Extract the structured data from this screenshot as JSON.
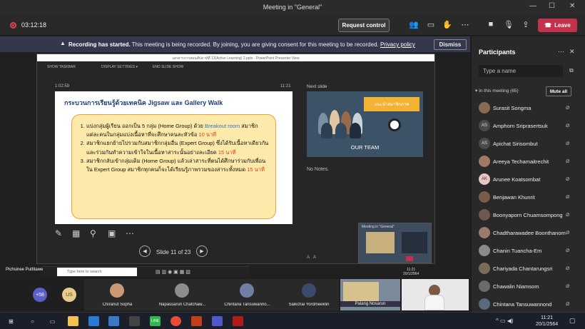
{
  "window": {
    "title": "Meeting in \"General\""
  },
  "toolbar": {
    "timer": "03:12:18",
    "request_control_label": "Request control",
    "leave_label": "Leave"
  },
  "banner": {
    "title": "Recording has started.",
    "message": "This meeting is being recorded. By joining, you are giving consent for this meeting to be recorded.",
    "link": "Privacy policy",
    "dismiss_label": "Dismiss"
  },
  "presenter": {
    "window_title": "เอกสารการสอนสัปดาห์ที่ 13(Active Learning) 2.pptx - PowerPoint Presenter View",
    "menu": [
      "SHOW TASKBAR",
      "DISPLAY SETTINGS ▾",
      "END SLIDE SHOW"
    ],
    "elapsed": "1:02:59",
    "clock": "11:21",
    "next_slide_label": "Next slide",
    "next_slide": {
      "banner": "แนะนำสมาชิกภาพ",
      "caption": "OUR TEAM"
    },
    "notes": "No Notes.",
    "slide_counter": "Slide 11 of 23",
    "slide": {
      "title": "กระบวนการเรียนรู้ด้วยเทคนิค Jigsaw และ Gallery Walk",
      "items": [
        {
          "pre": "แบ่งกลุ่มผู้เรียน ออกเป็น 5 กลุ่ม (Home Group) ด้วย ",
          "highlight": "Breakout room",
          "mid": " สมาชิกแต่ละคนในกลุ่มแบ่งเนื้อหาที่จะศึกษาคนละหัวข้อ ",
          "time": "10 นาที"
        },
        {
          "pre": "สมาชิกแยกย้ายไปรวมกับสมาชิกกลุ่มอื่น (Expert Group) ซึ่งได้รับเนื้อหาเดียวกัน และร่วมกันทำความเข้าใจในเนื้อหาสาระนั้นอย่างละเอียด ",
          "time": "15 นาที"
        },
        {
          "pre": "สมาชิกกลับเข้ากลุ่มเดิม (Home Group) แล้วเล่าสาระที่ตนได้ศึกษาร่วมกับเพื่อนใน Expert Group สมาชิกทุกคนก็จะได้เรียนรู้ภาพรวมของสาระทั้งหมด ",
          "time": "15 นาที"
        }
      ]
    },
    "presenter_name": "Pichsinee Puttitawesri",
    "inner_search_placeholder": "Type here to search",
    "inner_clock": "11:21",
    "inner_date": "20/1/2564",
    "mini_preview_title": "Meeting in \"General\""
  },
  "tiles": [
    {
      "label": "+58"
    },
    {
      "initials": "US"
    },
    {
      "name": "Chiranut Sopha"
    },
    {
      "name": "Napassarun Chatchaw..."
    },
    {
      "name": "Chintana Tansuwanno..."
    },
    {
      "name": "Saikchai Yordmeeklin"
    },
    {
      "name": "Palang Nosarun"
    }
  ],
  "participants": {
    "title": "Participants",
    "search_placeholder": "Type a name",
    "section_label": "In this meeting (65)",
    "mute_all_label": "Mute all",
    "list": [
      {
        "name": "Surasit Songma",
        "initials": ""
      },
      {
        "name": "Amphorn Sriprasertsuk",
        "initials": "AS"
      },
      {
        "name": "Apichat Sirisombut",
        "initials": "AS"
      },
      {
        "name": "Areeya Techamaitrechit",
        "initials": ""
      },
      {
        "name": "Arunee Koatsombat",
        "initials": "AK"
      },
      {
        "name": "Benjawan Khunrit",
        "initials": ""
      },
      {
        "name": "Boonyaporn Chuamsompong",
        "initials": ""
      },
      {
        "name": "Chadtharawadee Boonthanom",
        "initials": ""
      },
      {
        "name": "Chanin Tuancha-Em",
        "initials": ""
      },
      {
        "name": "Chariyada Chantarungsri",
        "initials": ""
      },
      {
        "name": "Chawalin Niamsom",
        "initials": ""
      },
      {
        "name": "Chintana Tansuwannond",
        "initials": ""
      }
    ]
  },
  "taskbar": {
    "time": "11:21",
    "date": "20/1/2564"
  },
  "colors": {
    "leave": "#c4314b",
    "banner": "#35374c",
    "slide_box": "#fde9a9",
    "slide_border": "#e8a13e",
    "accent_blue": "#2e74c9",
    "accent_red": "#e0401e"
  }
}
